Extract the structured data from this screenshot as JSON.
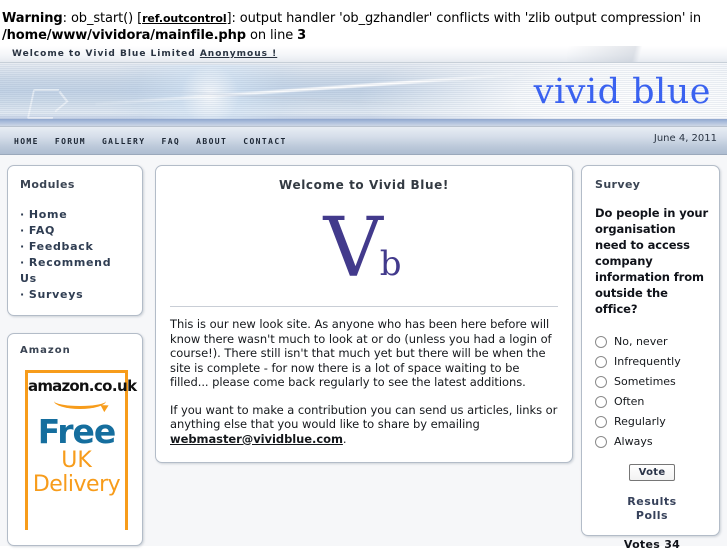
{
  "php_warning": {
    "label": "Warning",
    "text_1": ": ob_start() [",
    "ref_link": "ref.outcontrol",
    "text_2": "]: output handler 'ob_gzhandler' conflicts with 'zlib output compression' in ",
    "file_path": "/home/www/vividora/mainfile.php",
    "text_3": " on line ",
    "line_number": "3"
  },
  "welcome_bar": {
    "text": "Welcome to Vivid Blue Limited",
    "user_link": "Anonymous !"
  },
  "banner": {
    "logo_text": "vivid blue"
  },
  "nav": {
    "items": [
      {
        "label": "HOME"
      },
      {
        "label": "FORUM"
      },
      {
        "label": "GALLERY"
      },
      {
        "label": "FAQ"
      },
      {
        "label": "ABOUT"
      },
      {
        "label": "CONTACT"
      }
    ],
    "date": "June 4, 2011"
  },
  "sidebar_left": {
    "modules": {
      "title": "Modules",
      "items": [
        {
          "label": "Home"
        },
        {
          "label": "FAQ"
        },
        {
          "label": "Feedback"
        },
        {
          "label": "Recommend Us"
        },
        {
          "label": "Surveys"
        }
      ]
    },
    "amazon": {
      "title": "Amazon",
      "brand": "amazon",
      "tld": ".co.uk",
      "line1": "Free",
      "line2": "UK",
      "line3": "Delivery"
    }
  },
  "content": {
    "title": "Welcome to Vivid Blue!",
    "logo_main": "V",
    "logo_sup": "b",
    "paragraph_1": "This is our new look site. As anyone who has been here before will know there wasn't much to look at or do (unless you had a login of course!). There still isn't that much yet but there will be when the site is complete - for now there is a lot of space waiting to be filled... please come back regularly to see the latest additions.",
    "paragraph_2_before": "If you want to make a contribution you can send us articles, links or anything else that you would like to share by emailing ",
    "email_link": "webmaster@vividblue.com",
    "paragraph_2_after": "."
  },
  "survey": {
    "title": "Survey",
    "question": "Do people in your organisation need to access company information from outside the office?",
    "options": [
      {
        "label": "No, never"
      },
      {
        "label": "Infrequently"
      },
      {
        "label": "Sometimes"
      },
      {
        "label": "Often"
      },
      {
        "label": "Regularly"
      },
      {
        "label": "Always"
      }
    ],
    "vote_button": "Vote",
    "results_link": "Results",
    "polls_link": "Polls",
    "votes_text": "Votes 34"
  },
  "colors": {
    "brand_blue": "#3a62f0",
    "logo_purple": "#423a8c",
    "amazon_orange": "#f79c1b",
    "amazon_blue": "#156e9e",
    "panel_border": "#b3bcc8",
    "page_bg": "#f6f7f9"
  }
}
